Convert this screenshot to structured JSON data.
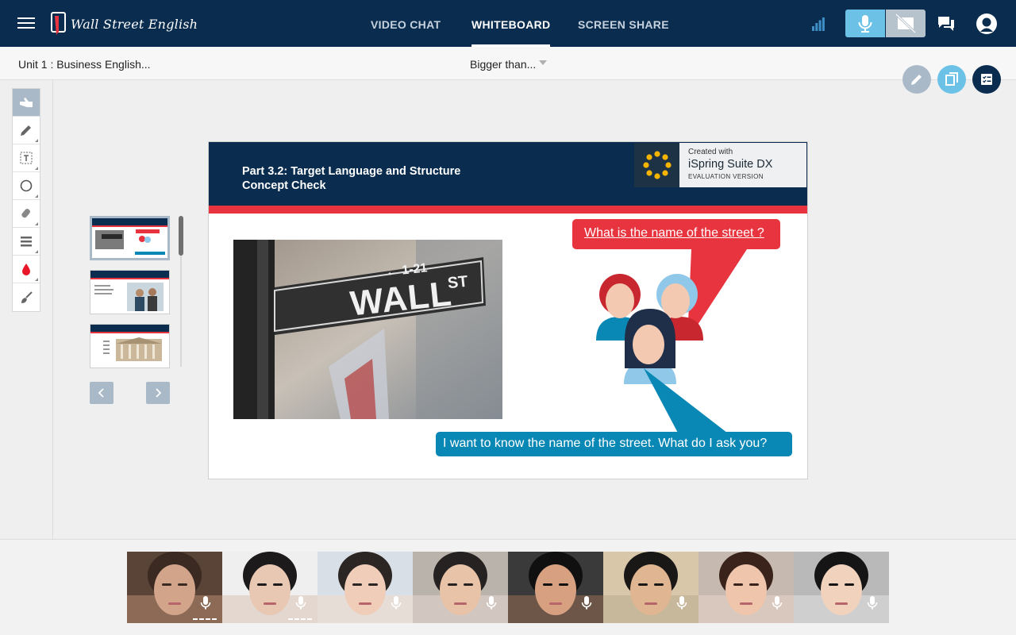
{
  "header": {
    "logo_text": "Wall Street English",
    "tabs": [
      {
        "label": "VIDEO CHAT",
        "active": false
      },
      {
        "label": "WHITEBOARD",
        "active": true
      },
      {
        "label": "SCREEN SHARE",
        "active": false
      }
    ],
    "icons": [
      "menu-icon",
      "signal-icon",
      "microphone-icon",
      "camera-off-icon",
      "chat-icon",
      "profile-icon"
    ],
    "colors": {
      "nav_bg": "#0a2d4f",
      "mic_active": "#6cc2e6",
      "cam_disabled": "#b6c2cc"
    }
  },
  "subheader": {
    "unit_title": "Unit 1 : Business English...",
    "slide_select": "Bigger than...",
    "actions": [
      "pencil-icon",
      "copy-icon",
      "checklist-icon"
    ]
  },
  "tools": [
    "pointer-icon",
    "pencil-icon",
    "text-icon",
    "circle-icon",
    "eraser-icon",
    "line-weight-icon",
    "color-drop-icon",
    "clear-brush-icon"
  ],
  "thumbnails": {
    "count": 3,
    "selected": 1
  },
  "slide": {
    "title_line1": "Part 3.2: Target Language and Structure",
    "title_line2": "Concept Check",
    "ispring_created": "Created with",
    "ispring_name": "iSpring Suite DX",
    "ispring_eval": "EVALUATION VERSION",
    "sign_text": "WALL",
    "sign_st": "ST",
    "sign_number": "← 1-21",
    "question": "What is the name of the street ?",
    "answer": "I want to know the name of the street. What do I ask you?",
    "colors": {
      "header": "#0a2d4f",
      "accent_red": "#e8343f",
      "accent_blue": "#0a88b5"
    }
  },
  "participants": [
    {
      "name": "participant-1",
      "speaking_level": true
    },
    {
      "name": "participant-2",
      "speaking_level": true
    },
    {
      "name": "participant-3",
      "speaking_level": false
    },
    {
      "name": "participant-4",
      "speaking_level": false
    },
    {
      "name": "participant-5",
      "speaking_level": false
    },
    {
      "name": "participant-6",
      "speaking_level": false
    },
    {
      "name": "participant-7",
      "speaking_level": false
    },
    {
      "name": "participant-8",
      "speaking_level": false
    }
  ]
}
